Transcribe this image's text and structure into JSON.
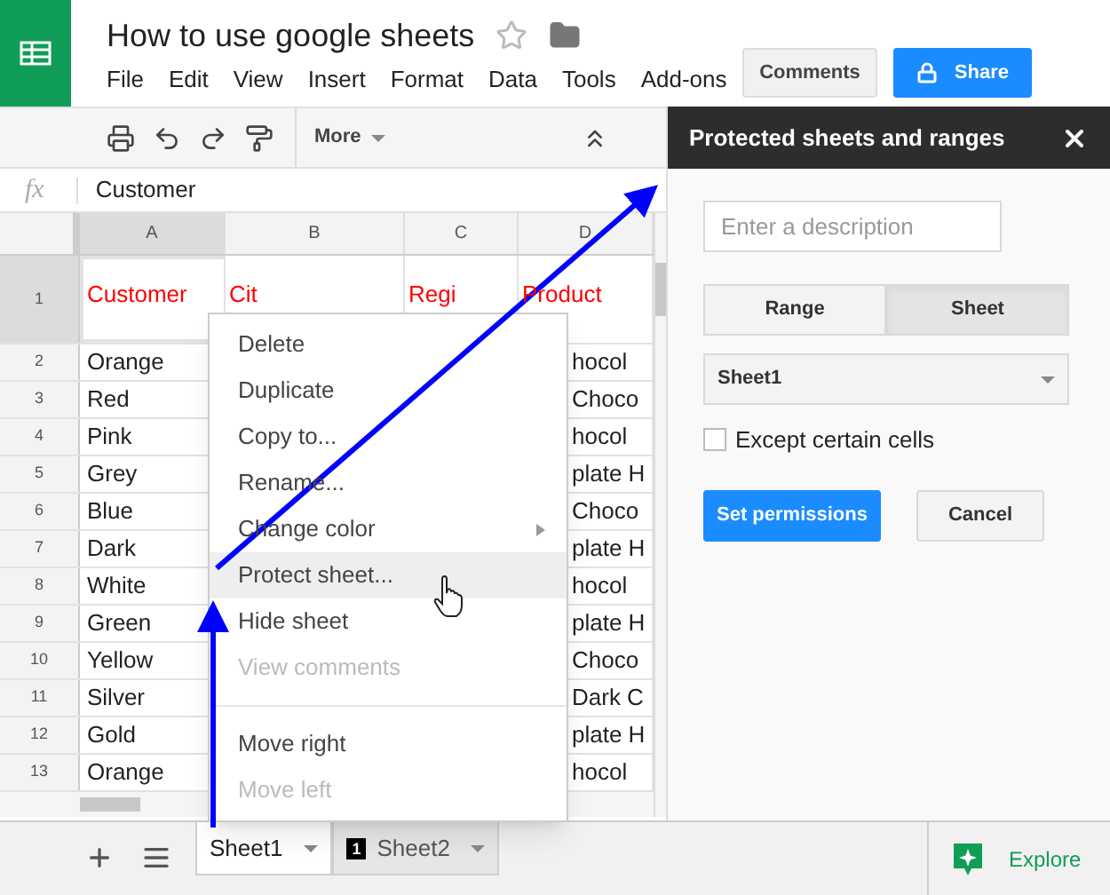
{
  "app": {
    "title": "How to use google sheets",
    "menus": [
      "File",
      "Edit",
      "View",
      "Insert",
      "Format",
      "Data",
      "Tools",
      "Add-ons"
    ],
    "comments_button": "Comments",
    "share_button": "Share"
  },
  "toolbar": {
    "more": "More"
  },
  "formula_bar": {
    "function_label": "fx",
    "value": "Customer"
  },
  "columns": [
    {
      "label": "A",
      "selected": true
    },
    {
      "label": "B",
      "selected": false
    },
    {
      "label": "C",
      "selected": false
    },
    {
      "label": "D",
      "selected": false
    }
  ],
  "rows": [
    {
      "number": "1",
      "selected": true,
      "kind": "header",
      "column_a": "Customer",
      "column_b": "Cit",
      "column_c": "Regi",
      "column_d": "Product"
    },
    {
      "number": "2",
      "selected": false,
      "kind": "data",
      "column_a": "Orange",
      "column_d": "hocol"
    },
    {
      "number": "3",
      "selected": false,
      "kind": "data",
      "column_a": "Red",
      "column_d": "Choco"
    },
    {
      "number": "4",
      "selected": false,
      "kind": "data",
      "column_a": "Pink",
      "column_d": "hocol"
    },
    {
      "number": "5",
      "selected": false,
      "kind": "data",
      "column_a": "Grey",
      "column_d": "plate H"
    },
    {
      "number": "6",
      "selected": false,
      "kind": "data",
      "column_a": "Blue",
      "column_d": "Choco"
    },
    {
      "number": "7",
      "selected": false,
      "kind": "data",
      "column_a": "Dark",
      "column_d": "plate H"
    },
    {
      "number": "8",
      "selected": false,
      "kind": "data",
      "column_a": "White",
      "column_d": "hocol"
    },
    {
      "number": "9",
      "selected": false,
      "kind": "data",
      "column_a": "Green",
      "column_d": "plate H"
    },
    {
      "number": "10",
      "selected": false,
      "kind": "data",
      "column_a": "Yellow",
      "column_d": "Choco"
    },
    {
      "number": "11",
      "selected": false,
      "kind": "data",
      "column_a": "Silver",
      "column_d": "Dark C"
    },
    {
      "number": "12",
      "selected": false,
      "kind": "data",
      "column_a": "Gold",
      "column_d": "plate H"
    },
    {
      "number": "13",
      "selected": false,
      "kind": "data",
      "column_a": "Orange",
      "column_d": "hocol"
    }
  ],
  "context_menu": [
    {
      "label": "Delete",
      "disabled": false,
      "selected": false,
      "submenu": false,
      "divider_before": false
    },
    {
      "label": "Duplicate",
      "disabled": false,
      "selected": false,
      "submenu": false,
      "divider_before": false
    },
    {
      "label": "Copy to...",
      "disabled": false,
      "selected": false,
      "submenu": false,
      "divider_before": false
    },
    {
      "label": "Rename...",
      "disabled": false,
      "selected": false,
      "submenu": false,
      "divider_before": false
    },
    {
      "label": "Change color",
      "disabled": false,
      "selected": false,
      "submenu": true,
      "divider_before": false
    },
    {
      "label": "Protect sheet...",
      "disabled": false,
      "selected": true,
      "submenu": false,
      "divider_before": false
    },
    {
      "label": "Hide sheet",
      "disabled": false,
      "selected": false,
      "submenu": false,
      "divider_before": false
    },
    {
      "label": "View comments",
      "disabled": true,
      "selected": false,
      "submenu": false,
      "divider_before": false
    },
    {
      "label": "Move right",
      "disabled": false,
      "selected": false,
      "submenu": false,
      "divider_before": true
    },
    {
      "label": "Move left",
      "disabled": true,
      "selected": false,
      "submenu": false,
      "divider_before": false
    }
  ],
  "panel": {
    "title": "Protected sheets and ranges",
    "description": {
      "placeholder": "Enter a description"
    },
    "scope_tabs": [
      {
        "label": "Range",
        "selected": false
      },
      {
        "label": "Sheet",
        "selected": true
      }
    ],
    "sheet_select": "Sheet1",
    "except_checkbox": {
      "label": "Except certain cells",
      "checked": false
    },
    "primary_button": "Set permissions",
    "secondary_button": "Cancel"
  },
  "sheet_tabs": [
    {
      "label": "Sheet1",
      "selected": true
    },
    {
      "label": "Sheet2",
      "selected": false,
      "badge": "1"
    }
  ],
  "explore": "Explore"
}
